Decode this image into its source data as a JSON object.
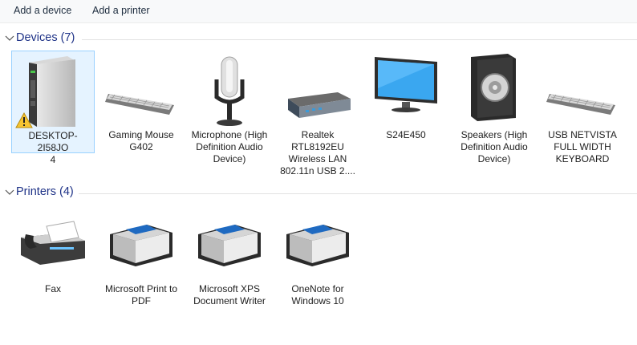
{
  "toolbar": {
    "add_device": "Add a device",
    "add_printer": "Add a printer"
  },
  "devices": {
    "title": "Devices (7)",
    "items": [
      {
        "label": "DESKTOP-2I58JO\n4",
        "icon": "computer-tower-icon",
        "warning": true
      },
      {
        "label": "Gaming Mouse G402",
        "icon": "keyboard-icon"
      },
      {
        "label": "Microphone (High Definition Audio Device)",
        "icon": "microphone-icon"
      },
      {
        "label": "Realtek RTL8192EU Wireless LAN 802.11n USB 2....",
        "icon": "network-adapter-icon"
      },
      {
        "label": "S24E450",
        "icon": "monitor-icon"
      },
      {
        "label": "Speakers (High Definition Audio Device)",
        "icon": "speaker-icon"
      },
      {
        "label": "USB NETVISTA FULL WIDTH KEYBOARD",
        "icon": "keyboard-icon"
      }
    ]
  },
  "printers": {
    "title": "Printers (4)",
    "items": [
      {
        "label": "Fax",
        "icon": "fax-icon"
      },
      {
        "label": "Microsoft Print to PDF",
        "icon": "printer-icon"
      },
      {
        "label": "Microsoft XPS Document Writer",
        "icon": "printer-icon"
      },
      {
        "label": "OneNote for Windows 10",
        "icon": "printer-icon"
      }
    ]
  }
}
